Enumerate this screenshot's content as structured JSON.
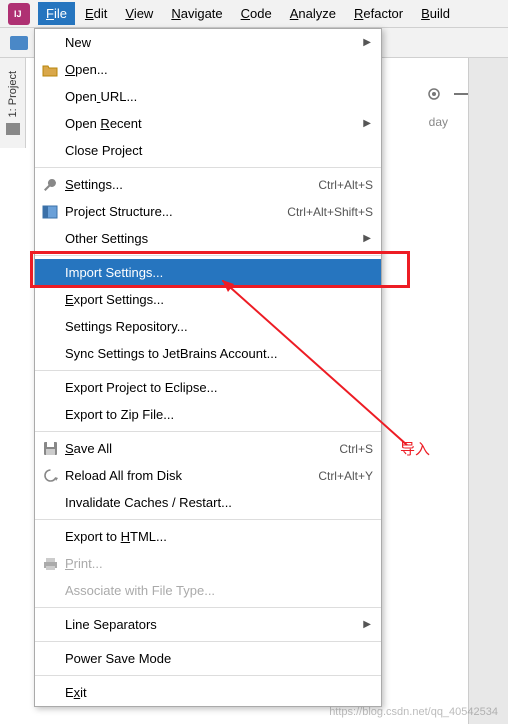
{
  "menubar": {
    "items": [
      "File",
      "Edit",
      "View",
      "Navigate",
      "Code",
      "Analyze",
      "Refactor",
      "Build"
    ],
    "active_index": 0
  },
  "side_tab": {
    "label": "1: Project"
  },
  "background_text": "day",
  "dropdown": {
    "groups": [
      [
        {
          "label": "New",
          "icon": "",
          "arrow": true
        },
        {
          "label": "Open...",
          "icon": "folder",
          "underline": 0
        },
        {
          "label": "Open URL...",
          "underline": 4
        },
        {
          "label": "Open Recent",
          "underline": 5,
          "arrow": true
        },
        {
          "label": "Close Project"
        }
      ],
      [
        {
          "label": "Settings...",
          "icon": "wrench",
          "underline": 0,
          "shortcut": "Ctrl+Alt+S"
        },
        {
          "label": "Project Structure...",
          "icon": "struct",
          "shortcut": "Ctrl+Alt+Shift+S"
        },
        {
          "label": "Other Settings",
          "arrow": true
        }
      ],
      [
        {
          "label": "Import Settings...",
          "highlighted": true
        },
        {
          "label": "Export Settings...",
          "underline": 0
        },
        {
          "label": "Settings Repository..."
        },
        {
          "label": "Sync Settings to JetBrains Account..."
        }
      ],
      [
        {
          "label": "Export Project to Eclipse..."
        },
        {
          "label": "Export to Zip File..."
        }
      ],
      [
        {
          "label": "Save All",
          "icon": "save",
          "underline": 0,
          "shortcut": "Ctrl+S"
        },
        {
          "label": "Reload All from Disk",
          "icon": "reload",
          "shortcut": "Ctrl+Alt+Y"
        },
        {
          "label": "Invalidate Caches / Restart..."
        }
      ],
      [
        {
          "label": "Export to HTML...",
          "underline": 10
        },
        {
          "label": "Print...",
          "icon": "print",
          "underline": 0,
          "disabled": true
        },
        {
          "label": "Associate with File Type...",
          "disabled": true
        }
      ],
      [
        {
          "label": "Line Separators",
          "arrow": true
        }
      ],
      [
        {
          "label": "Power Save Mode"
        }
      ],
      [
        {
          "label": "Exit",
          "underline": 1
        }
      ]
    ]
  },
  "annotation": "导入",
  "watermark": "https://blog.csdn.net/qq_40542534"
}
